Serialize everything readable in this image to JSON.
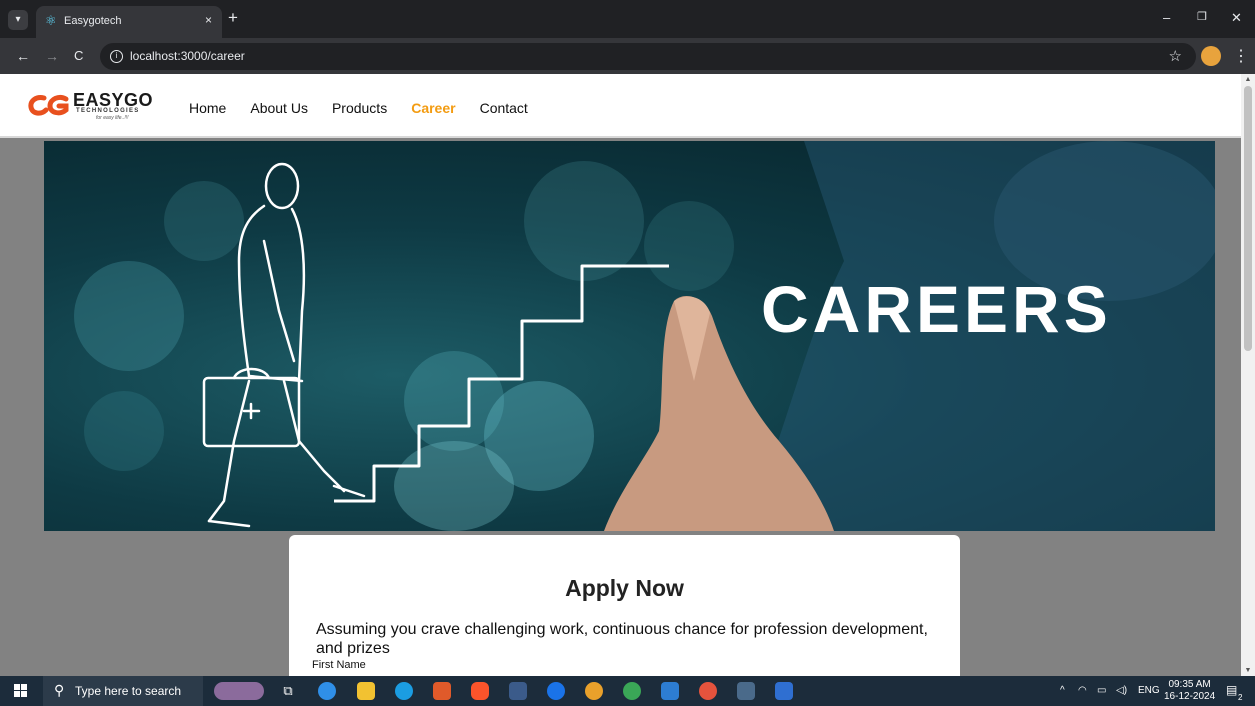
{
  "browser": {
    "tab_title": "Easygotech",
    "tab_close": "×",
    "new_tab": "+",
    "url": "localhost:3000/career",
    "back": "←",
    "forward": "→",
    "reload": "C",
    "star": "☆",
    "menu": "⋮",
    "minimize": "–",
    "restore": "❐",
    "close": "✕"
  },
  "site": {
    "logo_text": "EASYGO",
    "logo_sub": "TECHNOLOGIES",
    "logo_tag": "for easy life..!!!",
    "nav": [
      "Home",
      "About Us",
      "Products",
      "Career",
      "Contact"
    ],
    "active_nav": "Career",
    "accent_color": "#f39c12"
  },
  "hero": {
    "title": "CAREERS"
  },
  "form": {
    "title": "Apply Now",
    "description": "Assuming you crave challenging work, continuous chance for profession development, and prizes",
    "first_name_label": "First Name"
  },
  "taskbar": {
    "search_placeholder": "Type here to search",
    "tray_lang": "ENG",
    "time": "09:35 AM",
    "date": "16-12-2024",
    "notification_count": "2"
  }
}
